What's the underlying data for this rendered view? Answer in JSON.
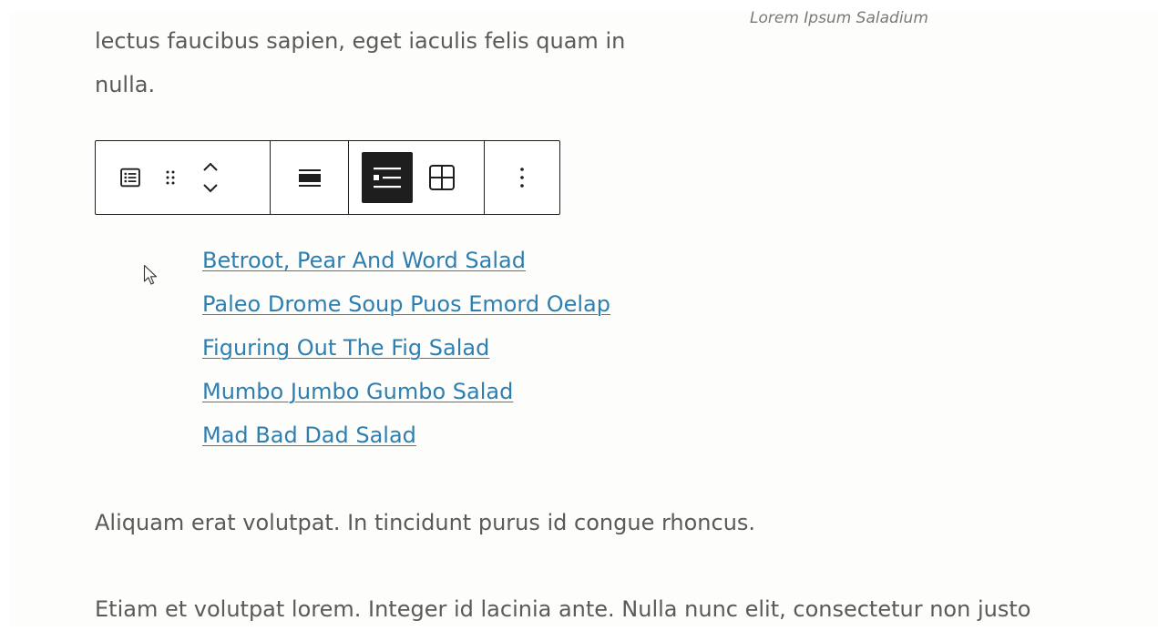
{
  "image_caption": "Lorem Ipsum Saladium",
  "intro_lines": [
    "lectus faucibus sapien, eget iaculis felis quam in",
    "nulla."
  ],
  "toolbar": {
    "block_type_icon": "list-view-icon",
    "drag_icon": "drag-handle-icon",
    "move_icon": "chevron-up-down-icon",
    "align_icon": "align-wide-icon",
    "list_layout_icon": "list-layout-icon",
    "grid_layout_icon": "grid-layout-icon",
    "more_icon": "more-vertical-icon",
    "active_layout": "list"
  },
  "links": [
    "Betroot, Pear And Word Salad",
    "Paleo Drome Soup Puos Emord Oelap",
    "Figuring Out The Fig Salad",
    "Mumbo Jumbo Gumbo Salad",
    "Mad Bad Dad Salad"
  ],
  "paragraph_2": "Aliquam erat volutpat. In tincidunt purus id congue rhoncus.",
  "paragraph_3": "Etiam et volutpat lorem. Integer id lacinia ante. Nulla nunc elit, consectetur non justo",
  "colors": {
    "link": "#2e7fb0",
    "text": "#5a5a5a",
    "toolbar_border": "#1e1e1e",
    "active_button": "#1e1e1e"
  }
}
